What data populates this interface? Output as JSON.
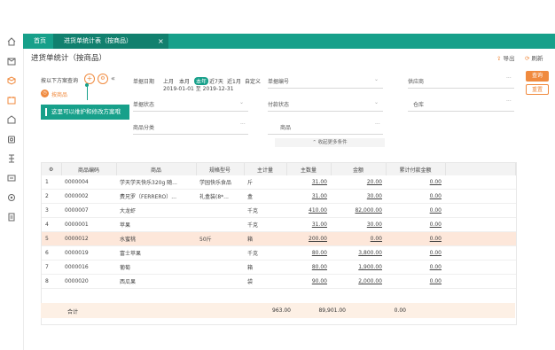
{
  "tabs": [
    {
      "label": "首页"
    },
    {
      "label": "进货单统计表（按商品）",
      "close": "×"
    }
  ],
  "page": {
    "title": "进货单统计（按商品）",
    "actions": [
      {
        "label": "导出"
      },
      {
        "label": "刷新"
      }
    ]
  },
  "buttons": {
    "query": "查询",
    "reset": "重置"
  },
  "scheme": {
    "label": "按以下方案查询",
    "current": "按商品",
    "tooltip": "这里可以维护和修改方案哦"
  },
  "filters": {
    "date_label": "单据日期",
    "periods": [
      "上月",
      "本月",
      "本年",
      "近7天",
      "近1月",
      "自定义"
    ],
    "selected_period": "本年",
    "date_range": "2019-01-01 至 2019-12-31",
    "order_no_label": "单据编号",
    "supplier_label": "供应商",
    "status_label": "单据状态",
    "pay_status_label": "付款状态",
    "warehouse_label": "仓库",
    "category_label": "商品分类",
    "product_label": "商品",
    "collapse_label": "收起更多条件"
  },
  "table": {
    "columns": [
      "⚙",
      "商品编码",
      "商品",
      "规格型号",
      "主计量",
      "主数量",
      "金额",
      "累计付款金额"
    ],
    "rows": [
      {
        "no": "1",
        "code": "0000004",
        "name": "学天学天快乐320g 随...",
        "spec": "学园快乐食品",
        "unit": "斤",
        "qty": "31.00",
        "amount": "20.00",
        "paid": "0.00"
      },
      {
        "no": "2",
        "code": "0000002",
        "name": "费兄罗（FERRERO）...",
        "spec": "礼盒装(8*...",
        "unit": "盒",
        "qty": "31.00",
        "amount": "30.00",
        "paid": "0.00"
      },
      {
        "no": "3",
        "code": "0000007",
        "name": "大龙虾",
        "spec": "",
        "unit": "千克",
        "qty": "410.00",
        "amount": "82,000.00",
        "paid": "0.00"
      },
      {
        "no": "4",
        "code": "0000001",
        "name": "苹果",
        "spec": "",
        "unit": "千克",
        "qty": "31.00",
        "amount": "30.00",
        "paid": "0.00"
      },
      {
        "no": "5",
        "code": "0000012",
        "name": "水蜜桃",
        "spec": "50斤",
        "unit": "箱",
        "qty": "200.00",
        "amount": "0.00",
        "paid": "0.00"
      },
      {
        "no": "6",
        "code": "0000019",
        "name": "富士苹果",
        "spec": "",
        "unit": "千克",
        "qty": "80.00",
        "amount": "3,800.00",
        "paid": "0.00"
      },
      {
        "no": "7",
        "code": "0000016",
        "name": "葡萄",
        "spec": "",
        "unit": "箱",
        "qty": "80.00",
        "amount": "1,900.00",
        "paid": "0.00"
      },
      {
        "no": "8",
        "code": "0000020",
        "name": "西瓜果",
        "spec": "",
        "unit": "袋",
        "qty": "90.00",
        "amount": "2,000.00",
        "paid": "0.00"
      }
    ],
    "total": {
      "label": "合计",
      "qty": "963.00",
      "amount": "89,901.00",
      "paid": "0.00"
    }
  },
  "colors": {
    "accent": "#17a08a",
    "orange": "#f08a3e",
    "highlight": "#fde7da"
  }
}
